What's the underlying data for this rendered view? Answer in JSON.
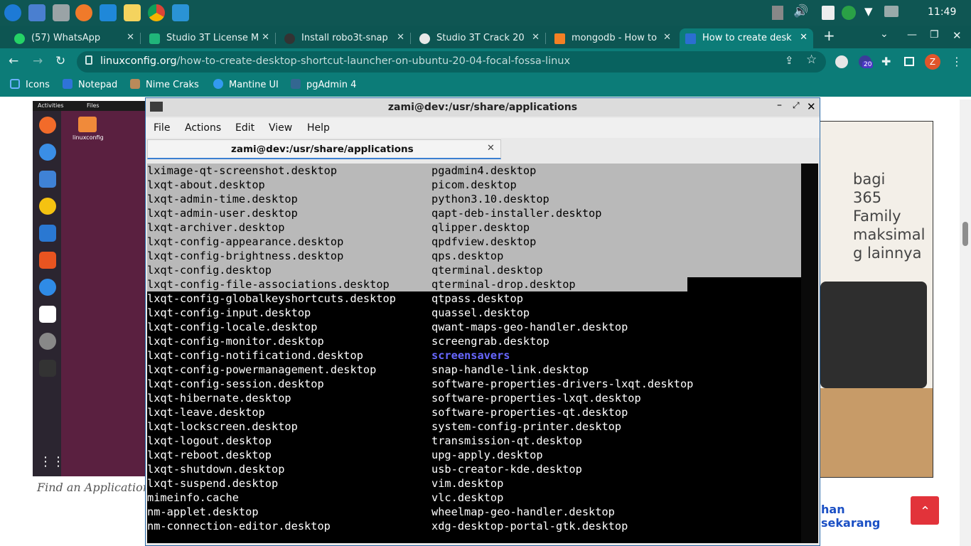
{
  "system": {
    "clock": "11:49"
  },
  "tabs": [
    {
      "title": "(57) WhatsApp",
      "icon": "whatsapp-icon",
      "active": false
    },
    {
      "title": "Studio 3T License M",
      "icon": "studio3t-icon",
      "active": false
    },
    {
      "title": "Install robo3t-snap",
      "icon": "snapcraft-icon",
      "active": false
    },
    {
      "title": "Studio 3T Crack 20",
      "icon": "globe-icon",
      "active": false
    },
    {
      "title": "mongodb - How to",
      "icon": "stackoverflow-icon",
      "active": false
    },
    {
      "title": "How to create desk",
      "icon": "linuxconfig-icon",
      "active": true
    }
  ],
  "address": {
    "domain": "linuxconfig.org",
    "path": "/how-to-create-desktop-shortcut-launcher-on-ubuntu-20-04-focal-fossa-linux"
  },
  "extensions": {
    "badge": "20",
    "profile_initial": "Z"
  },
  "bookmarks": [
    "Icons",
    "Notepad",
    "Nime Craks",
    "Mantine UI",
    "pgAdmin 4"
  ],
  "page": {
    "caption": "Find an Application",
    "ubuntu": {
      "activities": "Activities",
      "files": "Files",
      "folder_label": "linuxconfig"
    },
    "ad": {
      "lines": [
        "bagi",
        "365 Family",
        "maksimal",
        "g lainnya"
      ],
      "cta": "han sekarang"
    }
  },
  "terminal": {
    "window_title": "zami@dev:/usr/share/applications",
    "menu": [
      "File",
      "Actions",
      "Edit",
      "View",
      "Help"
    ],
    "tab_title": "zami@dev:/usr/share/applications",
    "rows": [
      [
        "lximage-qt-screenshot.desktop",
        "pgadmin4.desktop"
      ],
      [
        "lxqt-about.desktop",
        "picom.desktop"
      ],
      [
        "lxqt-admin-time.desktop",
        "python3.10.desktop"
      ],
      [
        "lxqt-admin-user.desktop",
        "qapt-deb-installer.desktop"
      ],
      [
        "lxqt-archiver.desktop",
        "qlipper.desktop"
      ],
      [
        "lxqt-config-appearance.desktop",
        "qpdfview.desktop"
      ],
      [
        "lxqt-config-brightness.desktop",
        "qps.desktop"
      ],
      [
        "lxqt-config.desktop",
        "qterminal.desktop"
      ],
      [
        "lxqt-config-file-associations.desktop",
        "qterminal-drop.desktop"
      ],
      [
        "lxqt-config-globalkeyshortcuts.desktop",
        "qtpass.desktop"
      ],
      [
        "lxqt-config-input.desktop",
        "quassel.desktop"
      ],
      [
        "lxqt-config-locale.desktop",
        "qwant-maps-geo-handler.desktop"
      ],
      [
        "lxqt-config-monitor.desktop",
        "screengrab.desktop"
      ],
      [
        "lxqt-config-notificationd.desktop",
        "screensavers"
      ],
      [
        "lxqt-config-powermanagement.desktop",
        "snap-handle-link.desktop"
      ],
      [
        "lxqt-config-session.desktop",
        "software-properties-drivers-lxqt.desktop"
      ],
      [
        "lxqt-hibernate.desktop",
        "software-properties-lxqt.desktop"
      ],
      [
        "lxqt-leave.desktop",
        "software-properties-qt.desktop"
      ],
      [
        "lxqt-lockscreen.desktop",
        "system-config-printer.desktop"
      ],
      [
        "lxqt-logout.desktop",
        "transmission-qt.desktop"
      ],
      [
        "lxqt-reboot.desktop",
        "upg-apply.desktop"
      ],
      [
        "lxqt-shutdown.desktop",
        "usb-creator-kde.desktop"
      ],
      [
        "lxqt-suspend.desktop",
        "vim.desktop"
      ],
      [
        "mimeinfo.cache",
        "vlc.desktop"
      ],
      [
        "nm-applet.desktop",
        "wheelmap-geo-handler.desktop"
      ],
      [
        "nm-connection-editor.desktop",
        "xdg-desktop-portal-gtk.desktop"
      ]
    ],
    "selected_rows": 9,
    "directory_entries": [
      "screensavers"
    ]
  }
}
